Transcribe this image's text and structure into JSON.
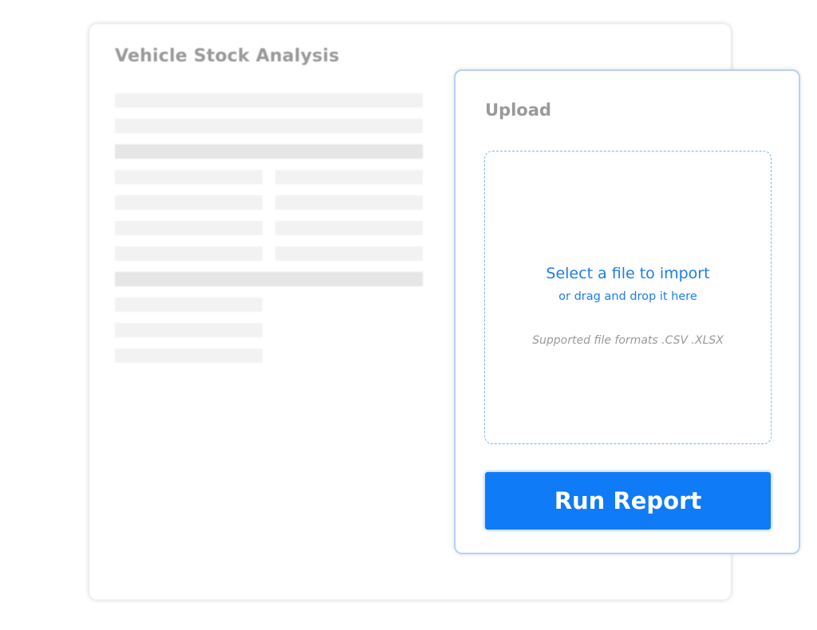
{
  "report": {
    "title": "Vehicle Stock Analysis"
  },
  "upload": {
    "title": "Upload",
    "drop_zone": {
      "primary": "Select a file to import",
      "secondary": "or drag and drop it here",
      "formats": "Supported file formats .CSV .XLSX"
    },
    "run_button_label": "Run Report"
  },
  "colors": {
    "accent": "#0f7bf6",
    "link": "#1e7cf2",
    "muted_text": "#9a9a9a",
    "skeleton": "#f2f2f2",
    "skeleton_dark": "#e6e6e6",
    "card_border": "#b8d2f1"
  }
}
